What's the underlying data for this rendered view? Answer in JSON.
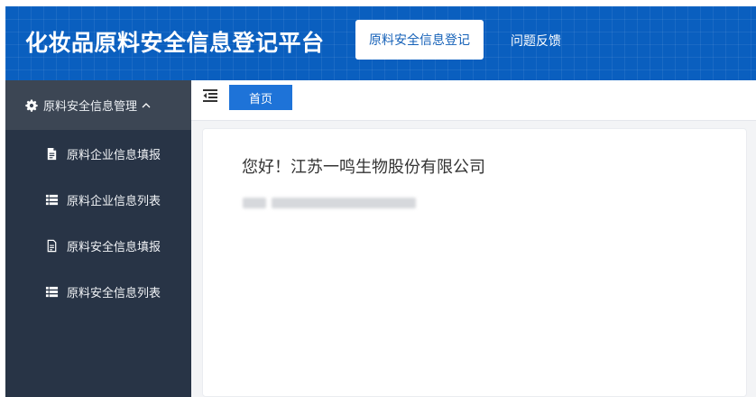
{
  "header": {
    "site_title": "化妆品原料安全信息登记平台",
    "nav": [
      {
        "label": "原料安全信息登记",
        "active": true
      },
      {
        "label": "问题反馈",
        "active": false
      }
    ]
  },
  "sidebar": {
    "group": {
      "label": "原料安全信息管理",
      "icon": "gear-icon",
      "state": "expanded"
    },
    "items": [
      {
        "label": "原料企业信息填报",
        "icon": "file-filled-icon"
      },
      {
        "label": "原料企业信息列表",
        "icon": "list-icon"
      },
      {
        "label": "原料安全信息填报",
        "icon": "file-outline-icon"
      },
      {
        "label": "原料安全信息列表",
        "icon": "list-icon"
      }
    ]
  },
  "tabs": {
    "collapse_icon": "indent-icon",
    "items": [
      {
        "label": "首页",
        "active": true
      }
    ]
  },
  "main": {
    "greeting": "您好！江苏一鸣生物股份有限公司",
    "redacted_line": true
  },
  "colors": {
    "header_blue": "#0a5fbf",
    "sidebar_dark": "#283446",
    "sidebar_group": "#3c4654",
    "accent": "#1e73d8",
    "content_bg": "#f3f4f6"
  }
}
